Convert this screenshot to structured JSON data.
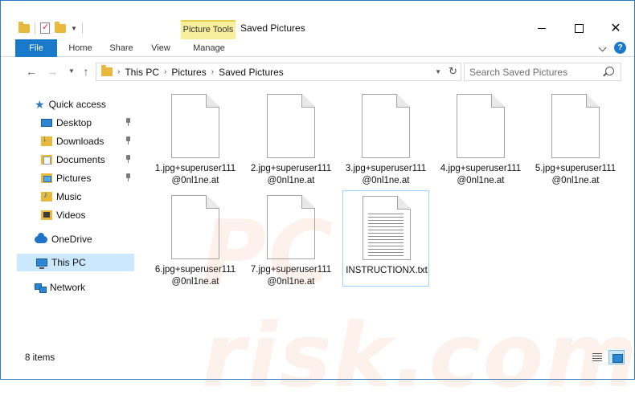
{
  "window": {
    "title": "Saved Pictures",
    "context_tab": "Picture Tools",
    "controls": {
      "close": "✕"
    }
  },
  "ribbon": {
    "tabs": [
      "File",
      "Home",
      "Share",
      "View",
      "Manage"
    ],
    "help": "?"
  },
  "address": {
    "crumbs": [
      "This PC",
      "Pictures",
      "Saved Pictures"
    ],
    "search_placeholder": "Search Saved Pictures"
  },
  "nav_pane": {
    "quick_access": "Quick access",
    "items": [
      "Desktop",
      "Downloads",
      "Documents",
      "Pictures",
      "Music",
      "Videos"
    ],
    "onedrive": "OneDrive",
    "this_pc": "This PC",
    "network": "Network"
  },
  "files": [
    {
      "name": "1.jpg+superuser111@0nl1ne.at",
      "type": "blank"
    },
    {
      "name": "2.jpg+superuser111@0nl1ne.at",
      "type": "blank"
    },
    {
      "name": "3.jpg+superuser111@0nl1ne.at",
      "type": "blank"
    },
    {
      "name": "4.jpg+superuser111@0nl1ne.at",
      "type": "blank"
    },
    {
      "name": "5.jpg+superuser111@0nl1ne.at",
      "type": "blank"
    },
    {
      "name": "6.jpg+superuser111@0nl1ne.at",
      "type": "blank"
    },
    {
      "name": "7.jpg+superuser111@0nl1ne.at",
      "type": "blank"
    },
    {
      "name": "INSTRUCTIONX.txt",
      "type": "text"
    }
  ],
  "status": {
    "item_count": "8 items"
  },
  "watermark": "PC risk.com"
}
